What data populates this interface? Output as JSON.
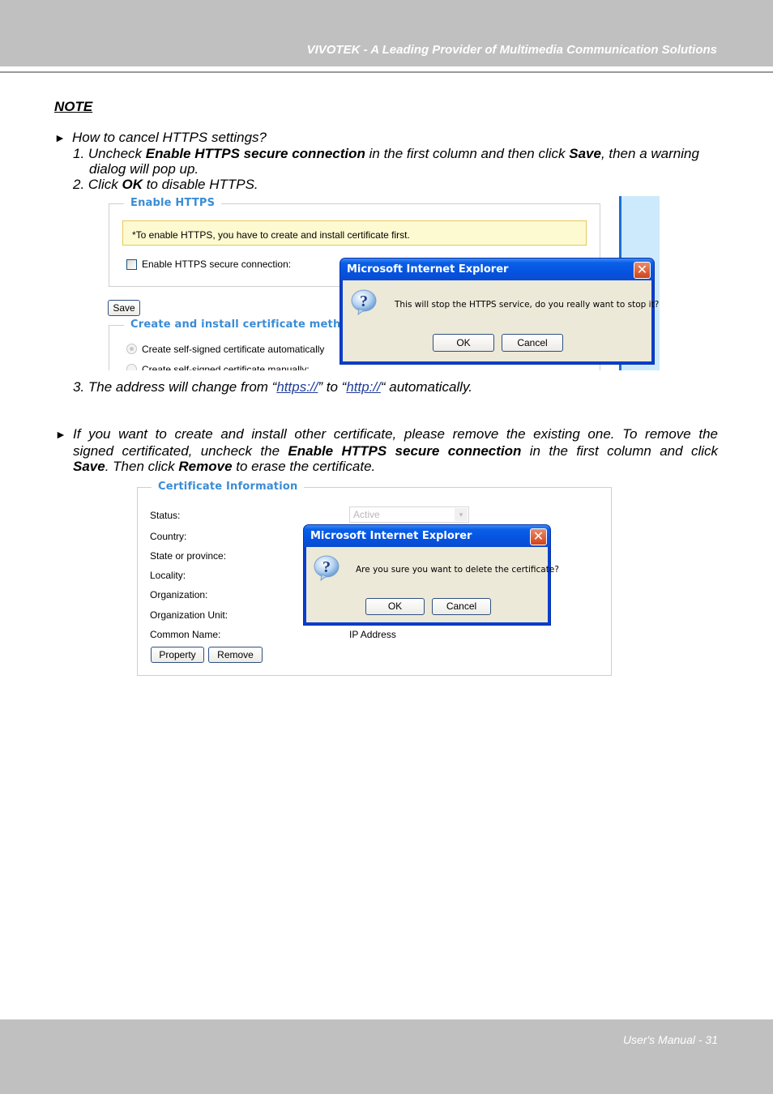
{
  "header": {
    "title": "VIVOTEK - A Leading Provider of Multimedia Communication Solutions"
  },
  "footer": {
    "page_label": "User's Manual - 31"
  },
  "note": {
    "title": "NOTE",
    "section1": {
      "bullet": "►",
      "heading": "How to cancel HTTPS settings?",
      "step1": {
        "prefix": "1. Uncheck ",
        "bold1": "Enable HTTPS secure connection",
        "middle": " in the first column and then click ",
        "bold2": "Save",
        "suffix": ", then a warning",
        "continuation": "dialog will pop up."
      },
      "step2": {
        "prefix": "2. Click ",
        "bold": "OK",
        "suffix": " to disable HTTPS."
      },
      "step3": {
        "prefix": "3. The address will change from “",
        "link1": "https://",
        "middle": "” to “",
        "link2": "http://",
        "suffix": "“ automatically."
      }
    },
    "section2": {
      "bullet": "►",
      "line1": "If you want to create and install other certificate, please remove the existing one. To remove the",
      "line2_prefix": "signed certificated, uncheck the ",
      "line2_bold": "Enable HTTPS secure connection",
      "line2_suffix": " in the first column and click",
      "line3_bold1": "Save",
      "line3_middle": ". Then click ",
      "line3_bold2": "Remove",
      "line3_suffix": " to erase the certificate."
    }
  },
  "screenshot1": {
    "enable_https_legend": "Enable HTTPS",
    "warning_text": "*To enable HTTPS, you have to create and install certificate first.",
    "checkbox_label": "Enable HTTPS secure connection:",
    "checkbox_checked": false,
    "save_button": "Save",
    "method_legend": "Create and install certificate method",
    "radio_options": [
      {
        "label": "Create self-signed certificate automatically",
        "selected": true
      },
      {
        "label": "Create self-signed certificate manually:",
        "selected": false
      }
    ],
    "dialog": {
      "title": "Microsoft Internet Explorer",
      "close_glyph": "✕",
      "message": "This will stop the HTTPS service, do you really want to stop it?",
      "ok_button": "OK",
      "cancel_button": "Cancel",
      "icon": "question-icon"
    }
  },
  "screenshot2": {
    "legend": "Certificate Information",
    "fields": [
      {
        "label": "Status:",
        "value": "Active"
      },
      {
        "label": "Country:",
        "value": ""
      },
      {
        "label": "State or province:",
        "value": ""
      },
      {
        "label": "Locality:",
        "value": ""
      },
      {
        "label": "Organization:",
        "value": ""
      },
      {
        "label": "Organization Unit:",
        "value": ""
      },
      {
        "label": "Common Name:",
        "value": "IP Address"
      }
    ],
    "property_button": "Property",
    "remove_button": "Remove",
    "select_arrow_glyph": "▾",
    "dialog": {
      "title": "Microsoft Internet Explorer",
      "close_glyph": "✕",
      "message": "Are you sure you want to delete the certificate?",
      "ok_button": "OK",
      "cancel_button": "Cancel",
      "icon": "question-icon"
    }
  }
}
